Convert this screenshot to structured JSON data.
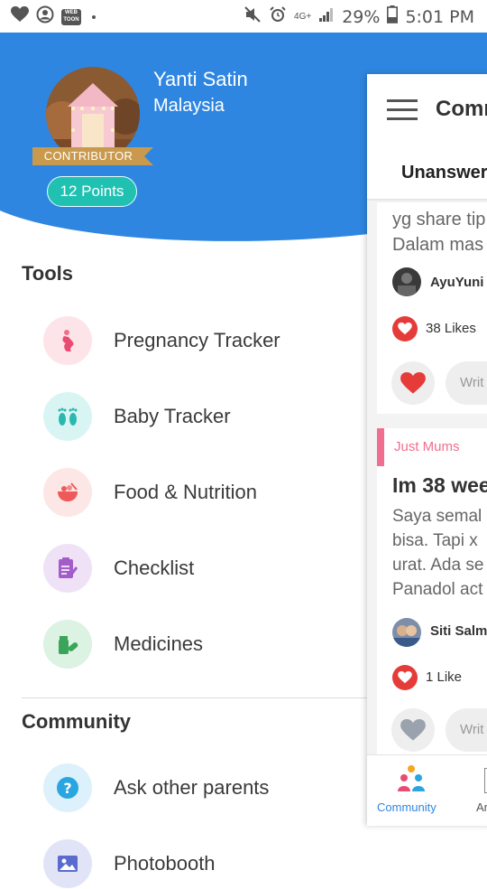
{
  "status_bar": {
    "web_badge": "WEB TOON",
    "network": "4G+",
    "battery": "29%",
    "time": "5:01 PM"
  },
  "profile": {
    "name": "Yanti Satin",
    "country": "Malaysia",
    "badge": "CONTRIBUTOR",
    "points": "12 Points"
  },
  "tools": {
    "title": "Tools",
    "items": [
      {
        "label": "Pregnancy Tracker",
        "icon": "pregnant-icon"
      },
      {
        "label": "Baby Tracker",
        "icon": "footprints-icon"
      },
      {
        "label": "Food & Nutrition",
        "icon": "bowl-icon"
      },
      {
        "label": "Checklist",
        "icon": "checklist-icon"
      },
      {
        "label": "Medicines",
        "icon": "medicine-icon"
      }
    ]
  },
  "community": {
    "title": "Community",
    "items": [
      {
        "label": "Ask other parents",
        "icon": "question-icon"
      },
      {
        "label": "Photobooth",
        "icon": "photo-icon"
      }
    ]
  },
  "panel": {
    "title": "Comm",
    "tab": "Unanswer",
    "post1": {
      "line1": "yg share tip",
      "line2": "Dalam mas",
      "author": "AyuYuni",
      "likes": "38 Likes",
      "write": "Writ"
    },
    "post2": {
      "category": "Just Mums",
      "title": "Im 38 wee",
      "line1": "Saya semal",
      "line2": "bisa. Tapi x",
      "line3": "urat. Ada se",
      "line4": "Panadol act",
      "author": "Siti Salm",
      "likes": "1 Like",
      "write": "Writ"
    },
    "nav": {
      "community": "Community",
      "next": "Ar"
    }
  },
  "colors": {
    "header_blue": "#2f86e0",
    "ribbon_gold": "#c99a4d",
    "points_teal": "#21c1b2",
    "like_red": "#e53c39",
    "category_pink": "#f26e90"
  }
}
